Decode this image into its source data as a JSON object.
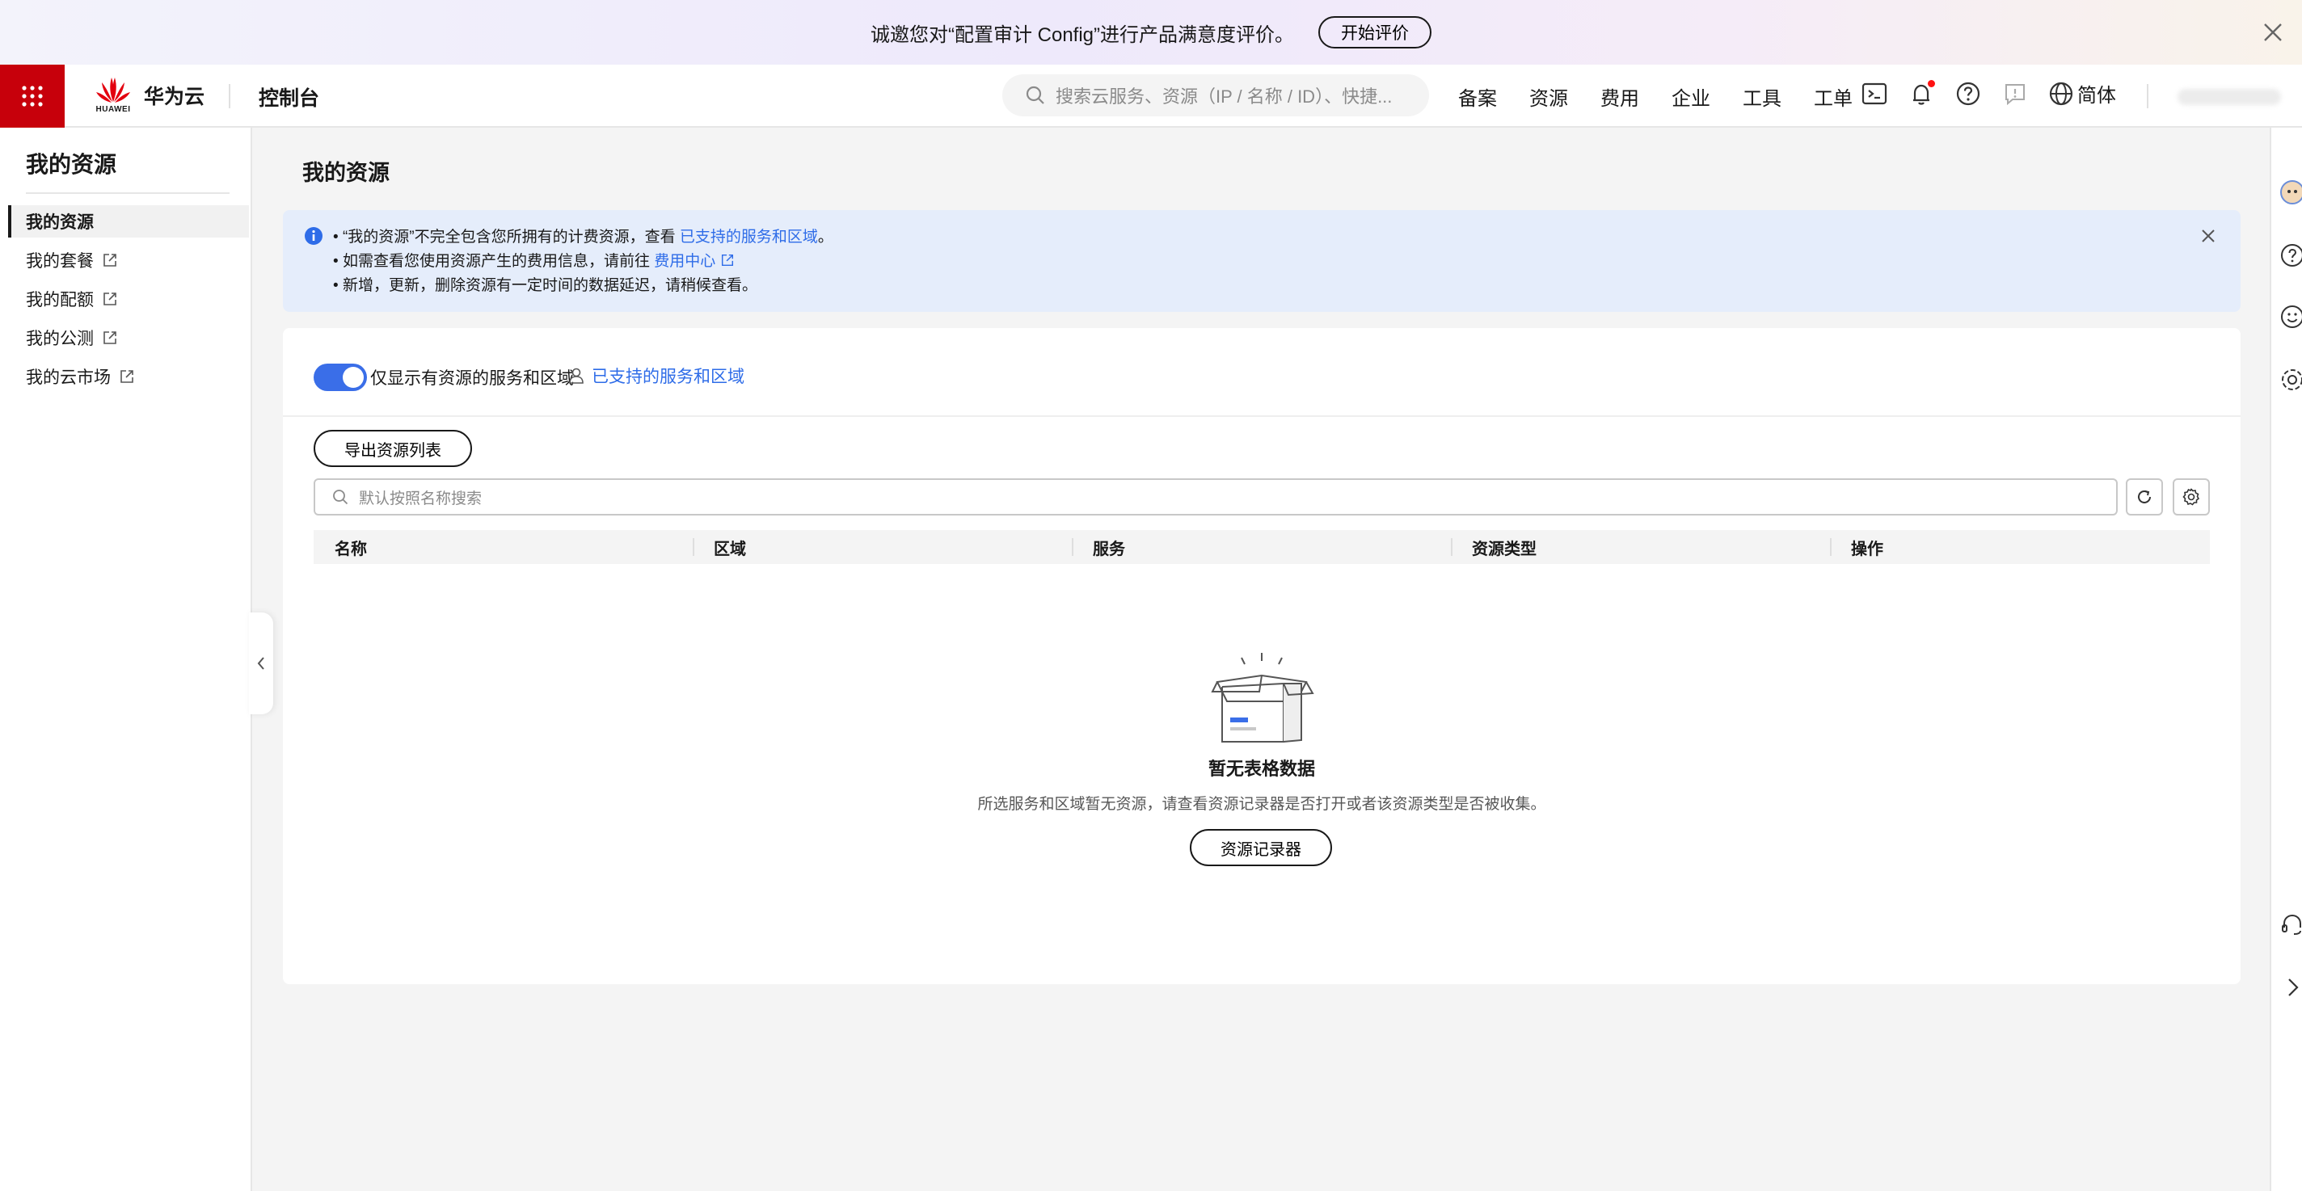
{
  "survey": {
    "text": "诚邀您对“配置审计 Config”进行产品满意度评价。",
    "button": "开始评价"
  },
  "topnav": {
    "logo_small": "HUAWEI",
    "logo_text": "华为云",
    "console": "控制台",
    "search_placeholder": "搜索云服务、资源（IP / 名称 / ID）、快捷...",
    "links": [
      "备案",
      "资源",
      "费用",
      "企业",
      "工具",
      "工单"
    ],
    "language": "简体"
  },
  "sidebar": {
    "title": "我的资源",
    "items": [
      {
        "label": "我的资源"
      },
      {
        "label": "我的套餐"
      },
      {
        "label": "我的配额"
      },
      {
        "label": "我的公测"
      },
      {
        "label": "我的云市场"
      }
    ]
  },
  "main": {
    "title": "我的资源",
    "notice": {
      "line1_prefix": "“我的资源”不完全包含您所拥有的计费资源，查看",
      "line1_link": "已支持的服务和区域",
      "line1_suffix": "。",
      "line2_prefix": "如需查看您使用资源产生的费用信息，请前往",
      "line2_link": "费用中心",
      "line3": "新增，更新，删除资源有一定时间的数据延迟，请稍候查看。"
    },
    "toggle_label": "仅显示有资源的服务和区域",
    "toggle_on": true,
    "support_link": "已支持的服务和区域",
    "export_button": "导出资源列表",
    "search_placeholder": "默认按照名称搜索",
    "columns": [
      "名称",
      "区域",
      "服务",
      "资源类型",
      "操作"
    ],
    "empty": {
      "title": "暂无表格数据",
      "description": "所选服务和区域暂无资源，请查看资源记录器是否打开或者该资源类型是否被收集。",
      "button": "资源记录器"
    }
  },
  "colors": {
    "brand_red": "#c7000b",
    "link_blue": "#2e6ce8",
    "notice_bg": "#e5edfb",
    "toggle_blue": "#3a6ee8"
  }
}
